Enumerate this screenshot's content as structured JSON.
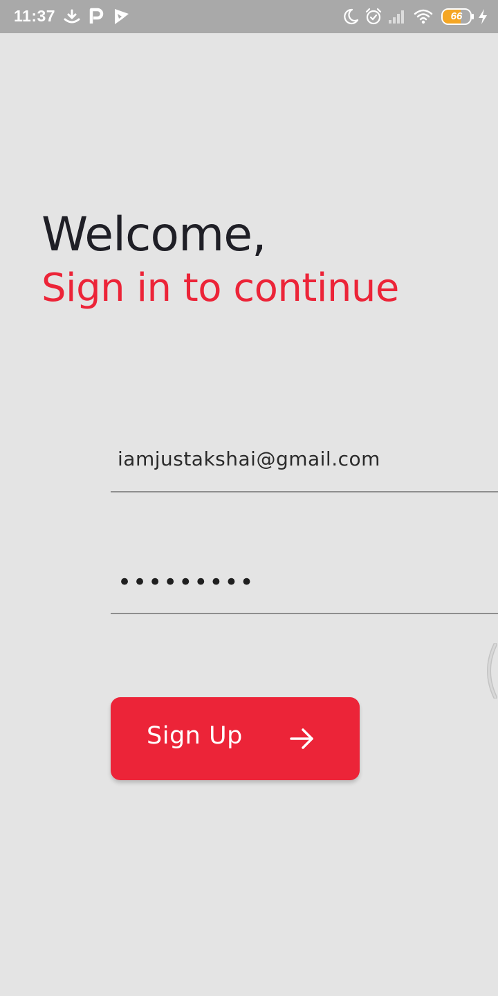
{
  "status_bar": {
    "time": "11:37",
    "battery_level": "66",
    "battery_fraction": 0.66,
    "icons_left": [
      "download-icon",
      "parking-icon",
      "play-store-icon"
    ],
    "icons_right": [
      "moon-icon",
      "alarm-icon",
      "signal-icon",
      "wifi-icon",
      "battery-icon",
      "charging-icon"
    ]
  },
  "header": {
    "title": "Welcome,",
    "subtitle": "Sign in to continue"
  },
  "form": {
    "email_value": "iamjustakshai@gmail.com",
    "password_masked": "•••••••••"
  },
  "button": {
    "label": "Sign Up",
    "icon": "arrow-right-icon"
  },
  "colors": {
    "accent": "#ec2438",
    "background": "#e4e4e4",
    "status_bar": "#a9a9a9",
    "title": "#1f1f26"
  }
}
